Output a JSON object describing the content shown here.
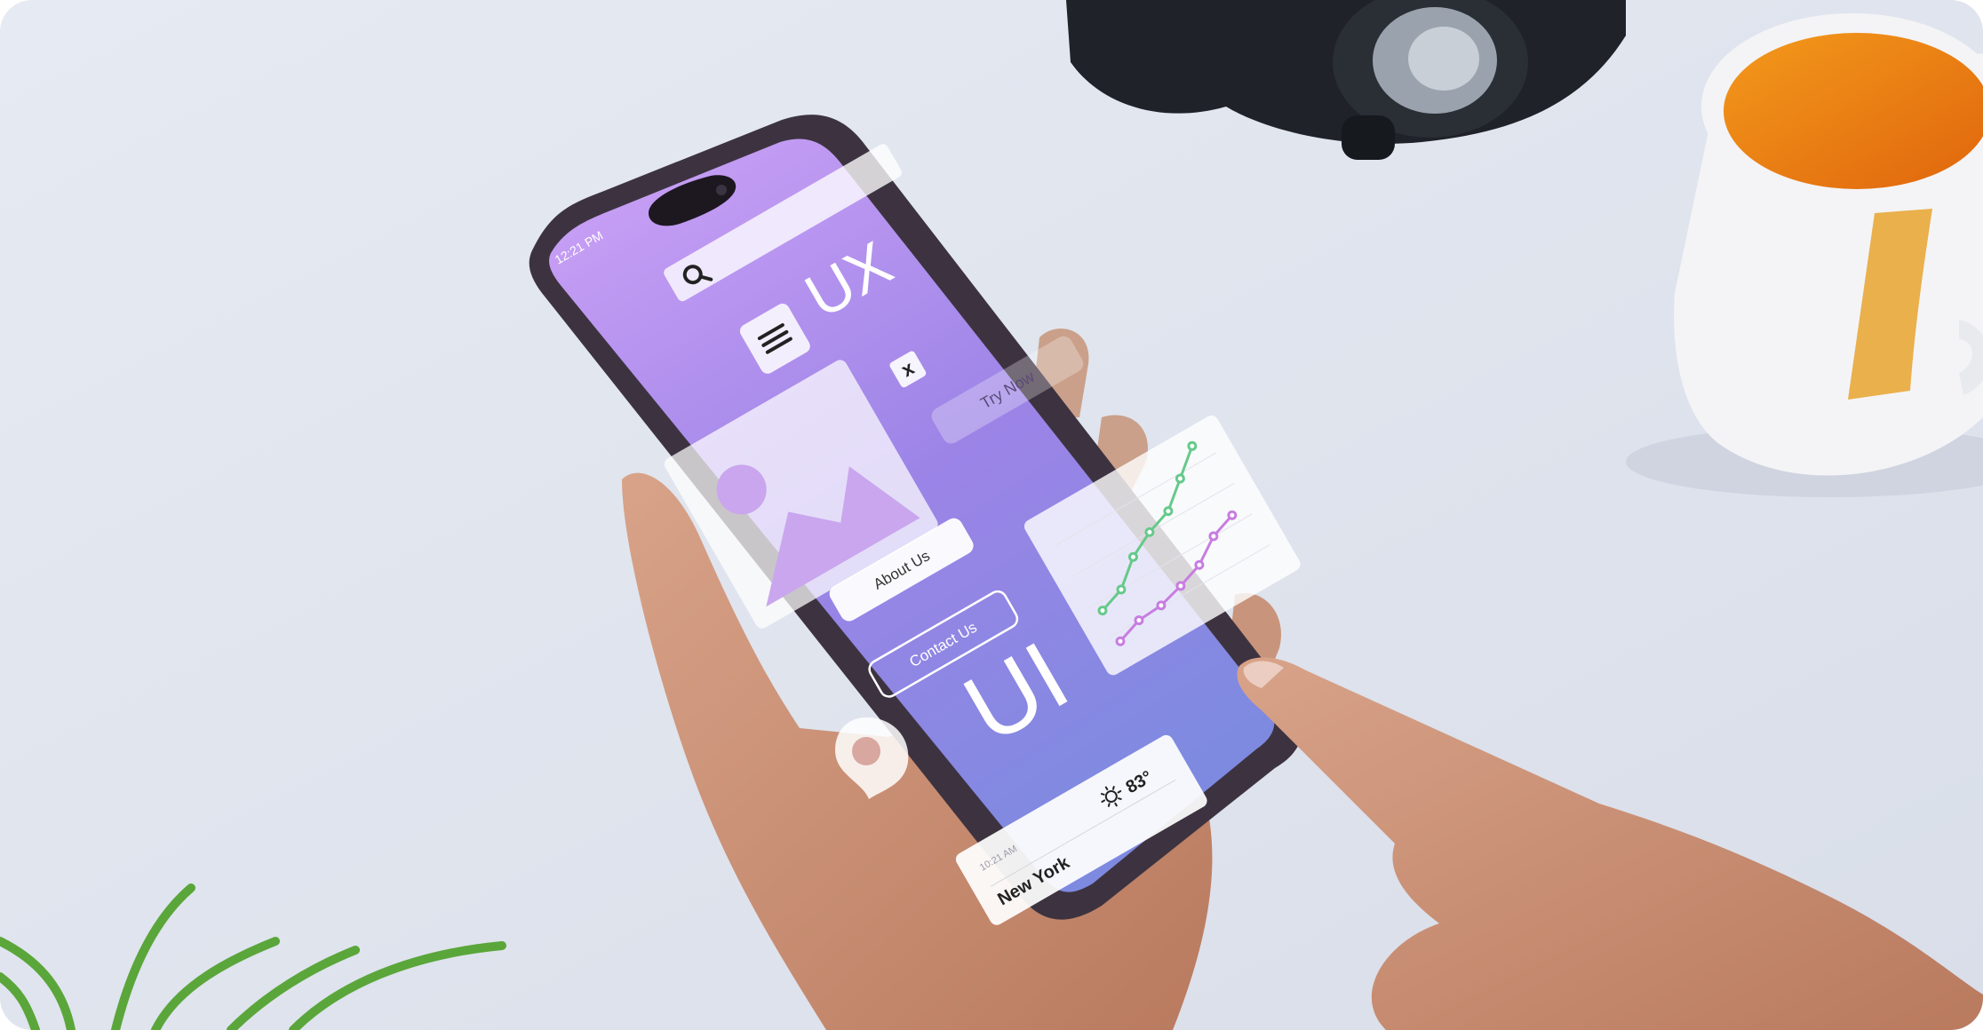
{
  "phone": {
    "status_time": "12:21 PM",
    "screen_gradient": [
      "#c9a0f6",
      "#9a83e6",
      "#7f88e0"
    ]
  },
  "overlay": {
    "ux_text": "UX",
    "ui_text": "UI",
    "close_glyph": "x",
    "try_now": "Try Now",
    "about_us": "About Us",
    "contact_us": "Contact Us",
    "weather": {
      "time": "10:21 AM",
      "city": "New York",
      "temperature": "83°",
      "icon": "sun-icon"
    },
    "chart_colors": {
      "green": "#66c98a",
      "purple": "#c77de0"
    }
  },
  "colors": {
    "background": "#dfe4ee",
    "mug_inside": "#ef7a0f",
    "mug_body": "#f4f4f6",
    "brush_stroke": "#e8a83a",
    "headphones": "#1f2228",
    "plant": "#5aa63a",
    "skin": "#c98f72"
  }
}
